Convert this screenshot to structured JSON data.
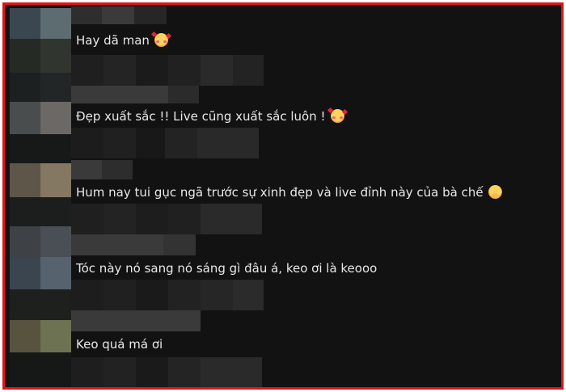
{
  "comments": [
    {
      "text": "Hay dã man",
      "emoji_icon": "smiling-face-with-hearts-icon"
    },
    {
      "text": "Đẹp xuất sắc !! Live cũng xuất sắc luôn !",
      "emoji_icon": "smiling-face-with-hearts-icon"
    },
    {
      "text": "Hum nay tui gục ngã trước sự xinh đẹp và live đỉnh này của bà chế",
      "emoji_icon": "face-with-hand-over-mouth-icon"
    },
    {
      "text": "Tóc này nó sang nó sáng gì đâu á, keo ơi là keooo",
      "emoji_icon": ""
    },
    {
      "text": "Keo quá má ơi",
      "emoji_icon": ""
    }
  ],
  "colors": {
    "frame_border": "#e0141c",
    "background": "#121212",
    "text": "#e8e8e8"
  }
}
